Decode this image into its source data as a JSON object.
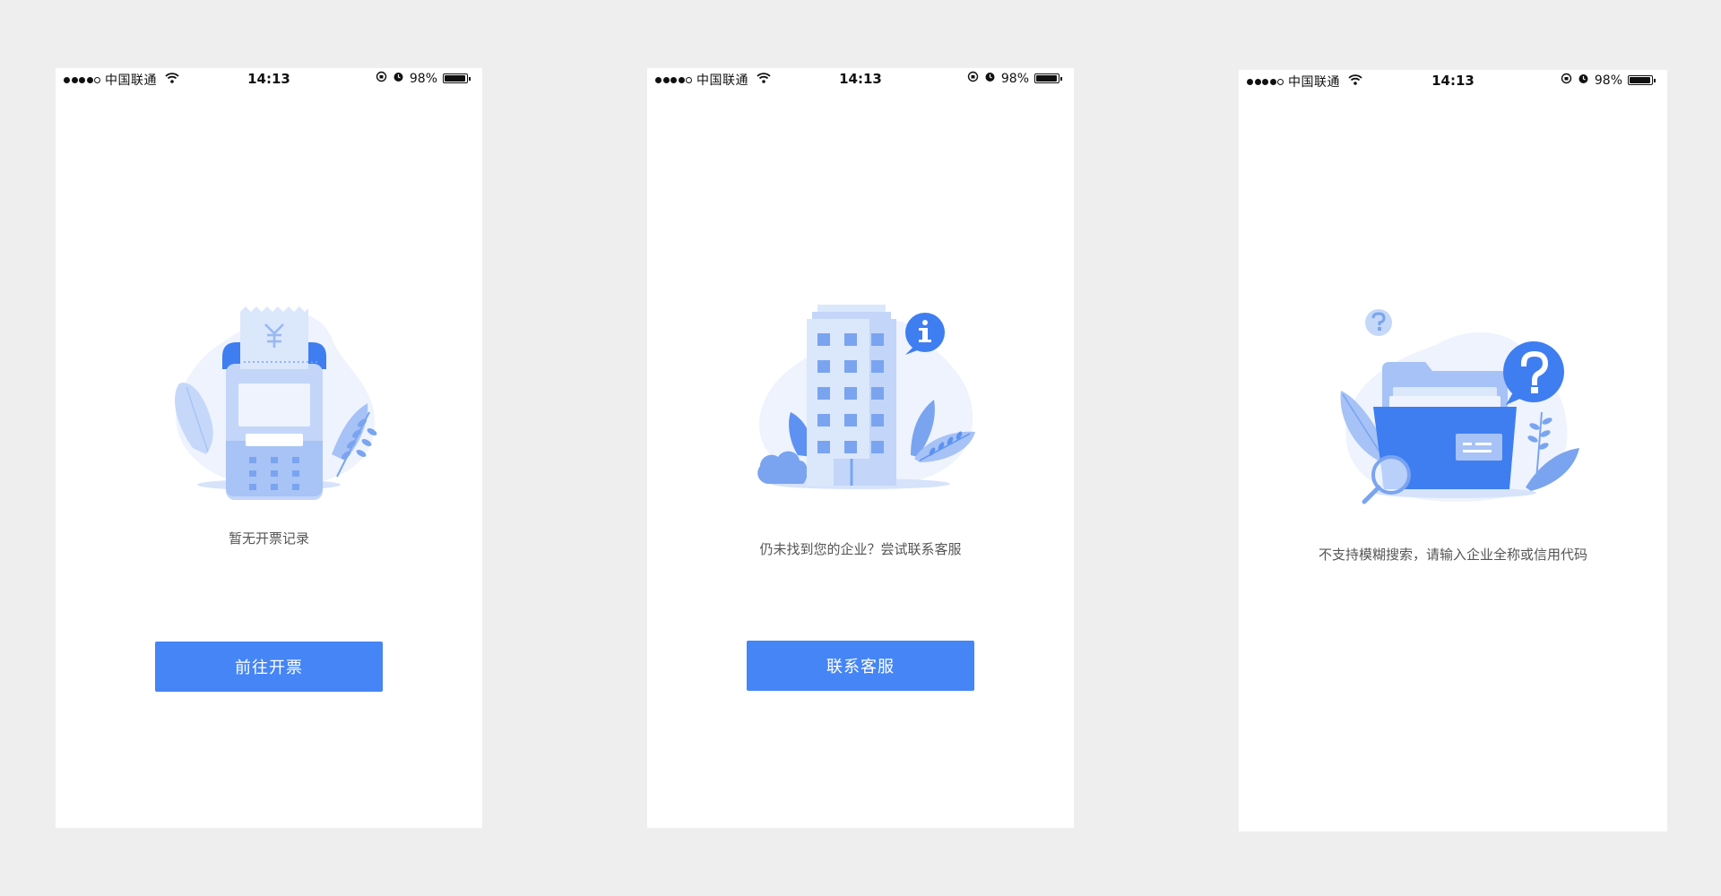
{
  "status_bar": {
    "carrier": "中国联通",
    "time": "14:13",
    "battery_text": "98%",
    "battery_level": 0.98
  },
  "screens": [
    {
      "illustration": "pos-terminal-receipt-icon",
      "message": "暂无开票记录",
      "button_label": "前往开票"
    },
    {
      "illustration": "office-building-info-icon",
      "message": "仍未找到您的企业？尝试联系客服",
      "button_label": "联系客服"
    },
    {
      "illustration": "folder-search-question-icon",
      "message": "不支持模糊搜索，请输入企业全称或信用代码"
    }
  ],
  "colors": {
    "background": "#eeeeee",
    "screen": "#ffffff",
    "primary_button": "#4585f5",
    "illustration_blue": "#3f7ef0",
    "illustration_light": "#dbe7fb"
  },
  "icons": [
    "signal-dots-icon",
    "wifi-icon",
    "orientation-lock-icon",
    "alarm-icon",
    "battery-icon",
    "yen-symbol-icon",
    "info-icon",
    "question-icon",
    "magnifier-icon"
  ]
}
